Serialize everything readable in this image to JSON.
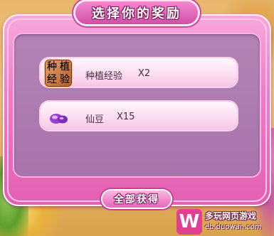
{
  "dialog": {
    "title": "选择你的奖励",
    "colors": {
      "frame": "#f37cc8",
      "panel": "#a974ad",
      "row": "#fce0f2",
      "text": "#4a2a44"
    }
  },
  "rewards": [
    {
      "icon": "planting-experience-icon",
      "icon_text": [
        "种",
        "植",
        "经",
        "验"
      ],
      "label": "种植经验",
      "quantity": "X2"
    },
    {
      "icon": "purple-bean-icon",
      "label": "仙豆",
      "quantity": "X15"
    }
  ],
  "collect_button": {
    "label": "全部获得"
  },
  "watermark": {
    "logo": "W",
    "title": "多玩网页游戏",
    "url": "eb.duowan.com"
  }
}
